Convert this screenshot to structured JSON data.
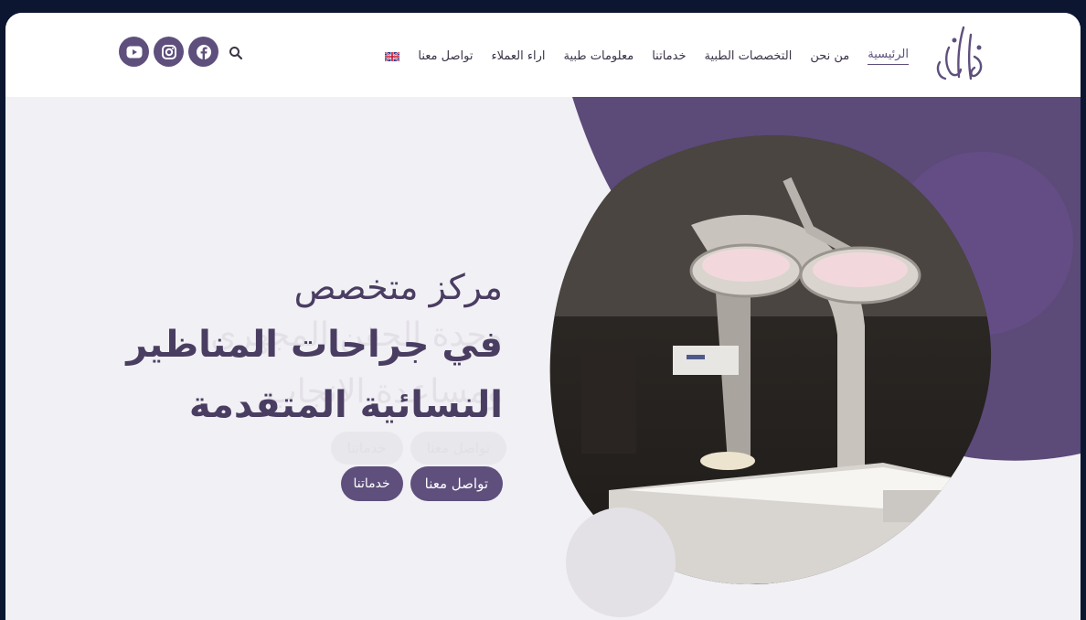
{
  "nav": {
    "items": [
      {
        "label": "الرئيسية",
        "active": true
      },
      {
        "label": "من نحن"
      },
      {
        "label": "التخصصات الطبية"
      },
      {
        "label": "خدماتنا"
      },
      {
        "label": "معلومات طبية"
      },
      {
        "label": "اراء العملاء"
      },
      {
        "label": "تواصل معنا"
      }
    ],
    "language_flag_icon": "uk-flag-icon",
    "search_icon": "search-icon",
    "social_icons": [
      "facebook-icon",
      "instagram-icon",
      "youtube-icon"
    ]
  },
  "hero": {
    "line1": "مركز متخصص",
    "line2": "في جراحات المناظير",
    "line3": "النسائية المتقدمة",
    "faded_line1": "وحدة الحقن المجهري",
    "faded_line2": "ومساعدة الإنجاب",
    "buttons": {
      "contact": "تواصل معنا",
      "services": "خدماتنا"
    }
  },
  "colors": {
    "accent": "#5e4f7d",
    "text_dark": "#4a3d62",
    "page_bg": "#f1f0f4",
    "outer_bg": "#0c1630"
  }
}
